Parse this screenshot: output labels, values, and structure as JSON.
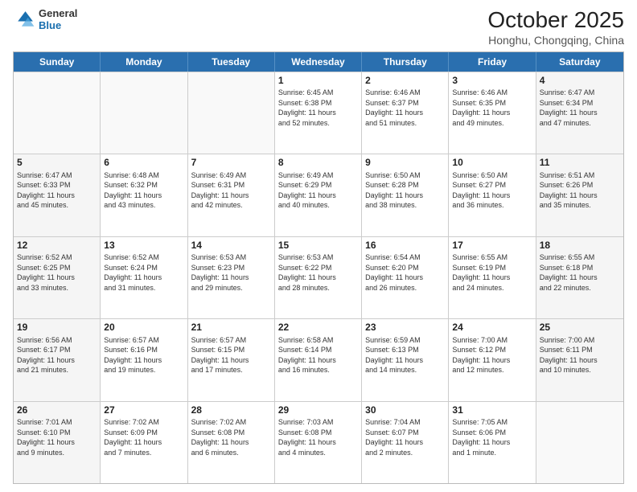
{
  "header": {
    "logo_line1": "General",
    "logo_line2": "Blue",
    "month": "October 2025",
    "location": "Honghu, Chongqing, China"
  },
  "weekdays": [
    "Sunday",
    "Monday",
    "Tuesday",
    "Wednesday",
    "Thursday",
    "Friday",
    "Saturday"
  ],
  "rows": [
    [
      {
        "day": "",
        "info": "",
        "shaded": false,
        "empty": true
      },
      {
        "day": "",
        "info": "",
        "shaded": false,
        "empty": true
      },
      {
        "day": "",
        "info": "",
        "shaded": false,
        "empty": true
      },
      {
        "day": "1",
        "info": "Sunrise: 6:45 AM\nSunset: 6:38 PM\nDaylight: 11 hours\nand 52 minutes.",
        "shaded": false
      },
      {
        "day": "2",
        "info": "Sunrise: 6:46 AM\nSunset: 6:37 PM\nDaylight: 11 hours\nand 51 minutes.",
        "shaded": false
      },
      {
        "day": "3",
        "info": "Sunrise: 6:46 AM\nSunset: 6:35 PM\nDaylight: 11 hours\nand 49 minutes.",
        "shaded": false
      },
      {
        "day": "4",
        "info": "Sunrise: 6:47 AM\nSunset: 6:34 PM\nDaylight: 11 hours\nand 47 minutes.",
        "shaded": true
      }
    ],
    [
      {
        "day": "5",
        "info": "Sunrise: 6:47 AM\nSunset: 6:33 PM\nDaylight: 11 hours\nand 45 minutes.",
        "shaded": true
      },
      {
        "day": "6",
        "info": "Sunrise: 6:48 AM\nSunset: 6:32 PM\nDaylight: 11 hours\nand 43 minutes.",
        "shaded": false
      },
      {
        "day": "7",
        "info": "Sunrise: 6:49 AM\nSunset: 6:31 PM\nDaylight: 11 hours\nand 42 minutes.",
        "shaded": false
      },
      {
        "day": "8",
        "info": "Sunrise: 6:49 AM\nSunset: 6:29 PM\nDaylight: 11 hours\nand 40 minutes.",
        "shaded": false
      },
      {
        "day": "9",
        "info": "Sunrise: 6:50 AM\nSunset: 6:28 PM\nDaylight: 11 hours\nand 38 minutes.",
        "shaded": false
      },
      {
        "day": "10",
        "info": "Sunrise: 6:50 AM\nSunset: 6:27 PM\nDaylight: 11 hours\nand 36 minutes.",
        "shaded": false
      },
      {
        "day": "11",
        "info": "Sunrise: 6:51 AM\nSunset: 6:26 PM\nDaylight: 11 hours\nand 35 minutes.",
        "shaded": true
      }
    ],
    [
      {
        "day": "12",
        "info": "Sunrise: 6:52 AM\nSunset: 6:25 PM\nDaylight: 11 hours\nand 33 minutes.",
        "shaded": true
      },
      {
        "day": "13",
        "info": "Sunrise: 6:52 AM\nSunset: 6:24 PM\nDaylight: 11 hours\nand 31 minutes.",
        "shaded": false
      },
      {
        "day": "14",
        "info": "Sunrise: 6:53 AM\nSunset: 6:23 PM\nDaylight: 11 hours\nand 29 minutes.",
        "shaded": false
      },
      {
        "day": "15",
        "info": "Sunrise: 6:53 AM\nSunset: 6:22 PM\nDaylight: 11 hours\nand 28 minutes.",
        "shaded": false
      },
      {
        "day": "16",
        "info": "Sunrise: 6:54 AM\nSunset: 6:20 PM\nDaylight: 11 hours\nand 26 minutes.",
        "shaded": false
      },
      {
        "day": "17",
        "info": "Sunrise: 6:55 AM\nSunset: 6:19 PM\nDaylight: 11 hours\nand 24 minutes.",
        "shaded": false
      },
      {
        "day": "18",
        "info": "Sunrise: 6:55 AM\nSunset: 6:18 PM\nDaylight: 11 hours\nand 22 minutes.",
        "shaded": true
      }
    ],
    [
      {
        "day": "19",
        "info": "Sunrise: 6:56 AM\nSunset: 6:17 PM\nDaylight: 11 hours\nand 21 minutes.",
        "shaded": true
      },
      {
        "day": "20",
        "info": "Sunrise: 6:57 AM\nSunset: 6:16 PM\nDaylight: 11 hours\nand 19 minutes.",
        "shaded": false
      },
      {
        "day": "21",
        "info": "Sunrise: 6:57 AM\nSunset: 6:15 PM\nDaylight: 11 hours\nand 17 minutes.",
        "shaded": false
      },
      {
        "day": "22",
        "info": "Sunrise: 6:58 AM\nSunset: 6:14 PM\nDaylight: 11 hours\nand 16 minutes.",
        "shaded": false
      },
      {
        "day": "23",
        "info": "Sunrise: 6:59 AM\nSunset: 6:13 PM\nDaylight: 11 hours\nand 14 minutes.",
        "shaded": false
      },
      {
        "day": "24",
        "info": "Sunrise: 7:00 AM\nSunset: 6:12 PM\nDaylight: 11 hours\nand 12 minutes.",
        "shaded": false
      },
      {
        "day": "25",
        "info": "Sunrise: 7:00 AM\nSunset: 6:11 PM\nDaylight: 11 hours\nand 10 minutes.",
        "shaded": true
      }
    ],
    [
      {
        "day": "26",
        "info": "Sunrise: 7:01 AM\nSunset: 6:10 PM\nDaylight: 11 hours\nand 9 minutes.",
        "shaded": true
      },
      {
        "day": "27",
        "info": "Sunrise: 7:02 AM\nSunset: 6:09 PM\nDaylight: 11 hours\nand 7 minutes.",
        "shaded": false
      },
      {
        "day": "28",
        "info": "Sunrise: 7:02 AM\nSunset: 6:08 PM\nDaylight: 11 hours\nand 6 minutes.",
        "shaded": false
      },
      {
        "day": "29",
        "info": "Sunrise: 7:03 AM\nSunset: 6:08 PM\nDaylight: 11 hours\nand 4 minutes.",
        "shaded": false
      },
      {
        "day": "30",
        "info": "Sunrise: 7:04 AM\nSunset: 6:07 PM\nDaylight: 11 hours\nand 2 minutes.",
        "shaded": false
      },
      {
        "day": "31",
        "info": "Sunrise: 7:05 AM\nSunset: 6:06 PM\nDaylight: 11 hours\nand 1 minute.",
        "shaded": false
      },
      {
        "day": "",
        "info": "",
        "shaded": true,
        "empty": true
      }
    ]
  ]
}
